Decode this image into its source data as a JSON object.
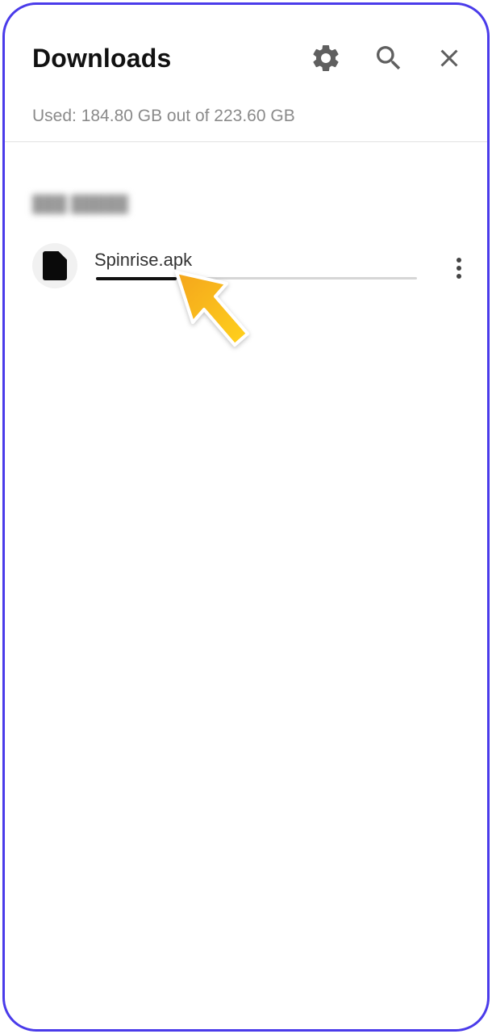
{
  "header": {
    "title": "Downloads",
    "icons": [
      "gear-icon",
      "search-icon",
      "close-icon"
    ]
  },
  "storage": {
    "text": "Used: 184.80 GB out of 223.60 GB"
  },
  "downloads": {
    "groups": [
      {
        "items": [
          {
            "file_name": "Spinrise.apk",
            "icon": "file-icon",
            "progress": 0.25
          }
        ]
      }
    ]
  },
  "colors": {
    "frame": "#4a3bea",
    "title": "#111111",
    "secondary_text": "#8a8a8a",
    "progress_fill": "#111111",
    "progress_track": "#d6d6d6",
    "pointer": "#f7a81b"
  }
}
